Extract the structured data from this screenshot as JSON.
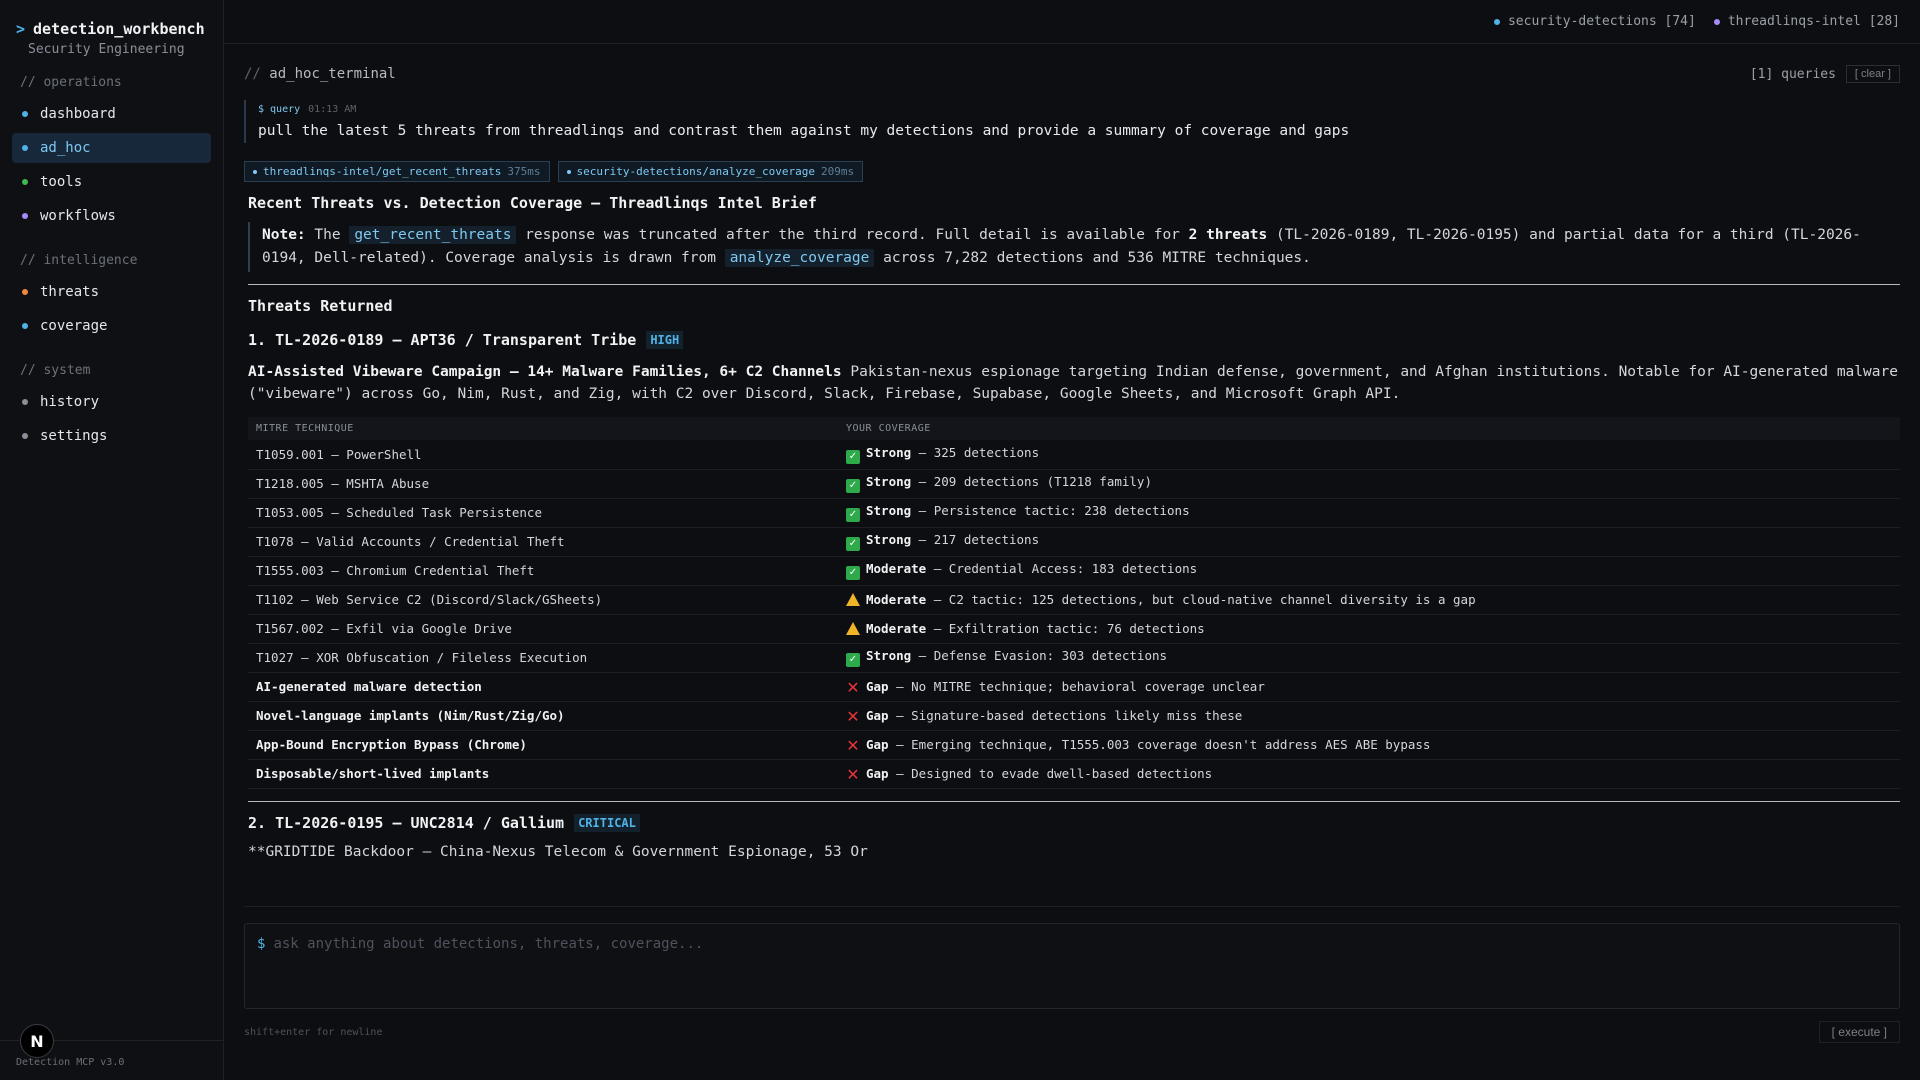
{
  "app": {
    "title": "detection_workbench",
    "prompt": ">",
    "subtitle": "Security Engineering",
    "footer": "Detection MCP v3.0",
    "logo_letter": "N"
  },
  "nav": {
    "sections": [
      {
        "label": "// operations",
        "items": [
          {
            "label": "dashboard",
            "color": "#4fb3e8"
          },
          {
            "label": "ad_hoc",
            "color": "#4fb3e8",
            "active": true
          },
          {
            "label": "tools",
            "color": "#3fb950"
          },
          {
            "label": "workflows",
            "color": "#a78bfa"
          }
        ]
      },
      {
        "label": "// intelligence",
        "items": [
          {
            "label": "threats",
            "color": "#f0883e"
          },
          {
            "label": "coverage",
            "color": "#4fb3e8"
          }
        ]
      },
      {
        "label": "// system",
        "items": [
          {
            "label": "history",
            "color": "#8a8f98"
          },
          {
            "label": "settings",
            "color": "#8a8f98"
          }
        ]
      }
    ]
  },
  "topbar": {
    "connections": [
      {
        "label": "security-detections [74]",
        "color": "#4fb3e8"
      },
      {
        "label": "threadlinqs-intel [28]",
        "color": "#a78bfa"
      }
    ]
  },
  "terminal": {
    "title_prefix": "//",
    "title": "ad_hoc_terminal",
    "query_count": "[1] queries",
    "clear_label": "[ clear ]",
    "query_label": "$ query",
    "query_time": "01:13 AM",
    "query_text": "pull the latest 5 threats from threadlinqs and contrast them against my detections and provide a summary of coverage and gaps",
    "tools": [
      {
        "name": "threadlinqs-intel/get_recent_threats",
        "ms": "375ms"
      },
      {
        "name": "security-detections/analyze_coverage",
        "ms": "209ms"
      }
    ]
  },
  "brief": {
    "title": "Recent Threats vs. Detection Coverage — Threadlinqs Intel Brief",
    "note_label": "Note:",
    "note_1": " The ",
    "note_code_1": "get_recent_threats",
    "note_2": " response was truncated after the third record. Full detail is available for ",
    "note_bold": "2 threats",
    "note_3": " (TL-2026-0189, TL-2026-0195) and partial data for a third (TL-2026-0194, Dell-related). Coverage analysis is drawn from ",
    "note_code_2": "analyze_coverage",
    "note_4": " across 7,282 detections and 536 MITRE techniques.",
    "section_title": "Threats Returned",
    "threat1": {
      "heading": "1. TL-2026-0189 — APT36 / Transparent Tribe",
      "severity": "HIGH",
      "summary_bold": "AI-Assisted Vibeware Campaign — 14+ Malware Families, 6+ C2 Channels",
      "summary_text": " Pakistan-nexus espionage targeting Indian defense, government, and Afghan institutions. Notable for AI-generated malware (\"vibeware\") across Go, Nim, Rust, and Zig, with C2 over Discord, Slack, Firebase, Supabase, Google Sheets, and Microsoft Graph API."
    },
    "table": {
      "headers": [
        "MITRE TECHNIQUE",
        "YOUR COVERAGE"
      ],
      "rows": [
        {
          "technique": "T1059.001 — PowerShell",
          "bold_tech": false,
          "status": "ok",
          "level": "Strong",
          "detail": " — 325 detections"
        },
        {
          "technique": "T1218.005 — MSHTA Abuse",
          "bold_tech": false,
          "status": "ok",
          "level": "Strong",
          "detail": " — 209 detections (T1218 family)"
        },
        {
          "technique": "T1053.005 — Scheduled Task Persistence",
          "bold_tech": false,
          "status": "ok",
          "level": "Strong",
          "detail": " — Persistence tactic: 238 detections"
        },
        {
          "technique": "T1078 — Valid Accounts / Credential Theft",
          "bold_tech": false,
          "status": "ok",
          "level": "Strong",
          "detail": " — 217 detections"
        },
        {
          "technique": "T1555.003 — Chromium Credential Theft",
          "bold_tech": false,
          "status": "ok",
          "level": "Moderate",
          "detail": " — Credential Access: 183 detections"
        },
        {
          "technique": "T1102 — Web Service C2 (Discord/Slack/GSheets)",
          "bold_tech": false,
          "status": "warn",
          "level": "Moderate",
          "detail": " — C2 tactic: 125 detections, but cloud-native channel diversity is a gap"
        },
        {
          "technique": "T1567.002 — Exfil via Google Drive",
          "bold_tech": false,
          "status": "warn",
          "level": "Moderate",
          "detail": " — Exfiltration tactic: 76 detections"
        },
        {
          "technique": "T1027 — XOR Obfuscation / Fileless Execution",
          "bold_tech": false,
          "status": "ok",
          "level": "Strong",
          "detail": " — Defense Evasion: 303 detections"
        },
        {
          "technique": "AI-generated malware detection",
          "bold_tech": true,
          "status": "gap",
          "level": "Gap",
          "detail": " — No MITRE technique; behavioral coverage unclear"
        },
        {
          "technique": "Novel-language implants (Nim/Rust/Zig/Go)",
          "bold_tech": true,
          "status": "gap",
          "level": "Gap",
          "detail": " — Signature-based detections likely miss these"
        },
        {
          "technique": "App-Bound Encryption Bypass (Chrome)",
          "bold_tech": true,
          "status": "gap",
          "level": "Gap",
          "detail": " — Emerging technique, T1555.003 coverage doesn't address AES ABE bypass"
        },
        {
          "technique": "Disposable/short-lived implants",
          "bold_tech": true,
          "status": "gap",
          "level": "Gap",
          "detail": " — Designed to evade dwell-based detections"
        }
      ]
    },
    "threat2": {
      "heading": "2. TL-2026-0195 — UNC2814 / Gallium",
      "severity": "CRITICAL",
      "partial": "**GRIDTIDE Backdoor — China-Nexus Telecom & Government Espionage, 53 Or"
    }
  },
  "input": {
    "prompt": "$",
    "placeholder": "ask anything about detections, threats, coverage...",
    "hint": "shift+enter for newline",
    "execute_label": "[ execute ]"
  }
}
